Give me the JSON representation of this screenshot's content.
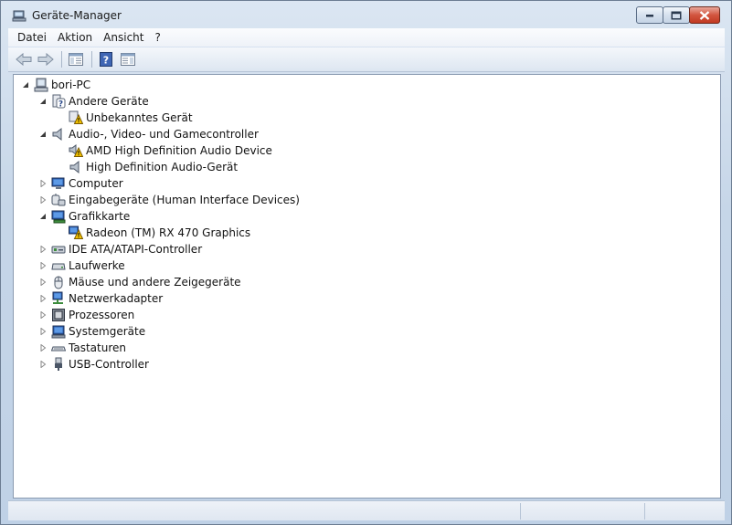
{
  "window": {
    "title": "Geräte-Manager"
  },
  "menu": {
    "items": [
      "Datei",
      "Aktion",
      "Ansicht",
      "?"
    ]
  },
  "tree": {
    "root": "bori-PC",
    "items": [
      {
        "label": "Andere Geräte",
        "level": 1,
        "expanded": true,
        "icon": "unknown-device-icon"
      },
      {
        "label": "Unbekanntes Gerät",
        "level": 2,
        "icon": "warning-device-icon"
      },
      {
        "label": "Audio-, Video- und Gamecontroller",
        "level": 1,
        "expanded": true,
        "icon": "speaker-icon"
      },
      {
        "label": "AMD High Definition Audio Device",
        "level": 2,
        "icon": "speaker-warning-icon"
      },
      {
        "label": "High Definition Audio-Gerät",
        "level": 2,
        "icon": "speaker-icon"
      },
      {
        "label": "Computer",
        "level": 1,
        "expanded": false,
        "icon": "computer-icon"
      },
      {
        "label": "Eingabegeräte (Human Interface Devices)",
        "level": 1,
        "expanded": false,
        "icon": "hid-icon"
      },
      {
        "label": "Grafikkarte",
        "level": 1,
        "expanded": true,
        "icon": "display-adapter-icon"
      },
      {
        "label": "Radeon (TM) RX 470 Graphics",
        "level": 2,
        "icon": "display-warning-icon"
      },
      {
        "label": "IDE ATA/ATAPI-Controller",
        "level": 1,
        "expanded": false,
        "icon": "ide-controller-icon"
      },
      {
        "label": "Laufwerke",
        "level": 1,
        "expanded": false,
        "icon": "drive-icon"
      },
      {
        "label": "Mäuse und andere Zeigegeräte",
        "level": 1,
        "expanded": false,
        "icon": "mouse-icon"
      },
      {
        "label": "Netzwerkadapter",
        "level": 1,
        "expanded": false,
        "icon": "network-icon"
      },
      {
        "label": "Prozessoren",
        "level": 1,
        "expanded": false,
        "icon": "processor-icon"
      },
      {
        "label": "Systemgeräte",
        "level": 1,
        "expanded": false,
        "icon": "system-device-icon"
      },
      {
        "label": "Tastaturen",
        "level": 1,
        "expanded": false,
        "icon": "keyboard-icon"
      },
      {
        "label": "USB-Controller",
        "level": 1,
        "expanded": false,
        "icon": "usb-icon"
      }
    ]
  }
}
